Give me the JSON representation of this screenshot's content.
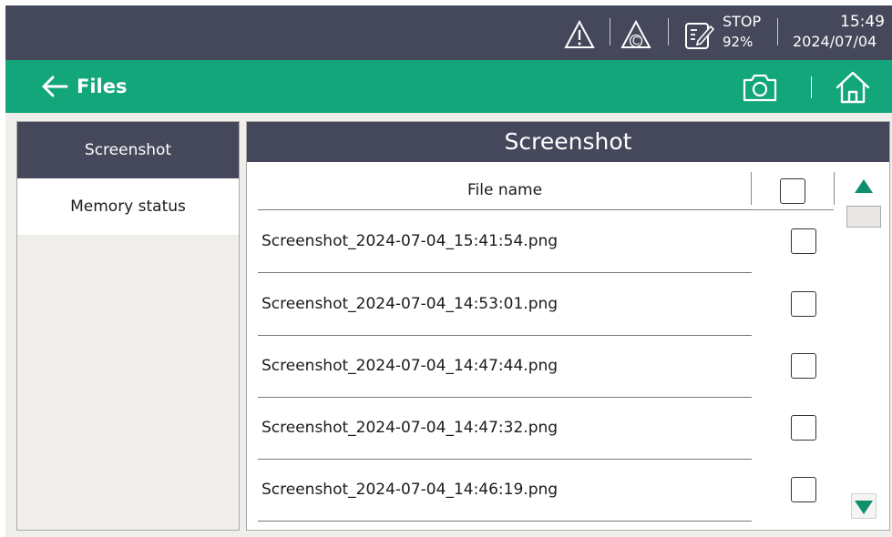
{
  "status_bar": {
    "run_state": "STOP",
    "percent": "92%",
    "time": "15:49",
    "date": "2024/07/04",
    "icons": [
      "warning-icon",
      "caution-c-icon",
      "edit-document-icon"
    ]
  },
  "title_bar": {
    "title": "Files",
    "back_icon": "arrow-left-icon",
    "camera_icon": "camera-icon",
    "home_icon": "home-icon"
  },
  "sidebar": {
    "items": [
      {
        "label": "Screenshot",
        "active": true
      },
      {
        "label": "Memory status",
        "active": false
      }
    ]
  },
  "panel": {
    "title": "Screenshot",
    "column_header": "File name",
    "select_all_checked": false,
    "files": [
      {
        "name": "Screenshot_2024-07-04_15:41:54.png",
        "checked": false
      },
      {
        "name": "Screenshot_2024-07-04_14:53:01.png",
        "checked": false
      },
      {
        "name": "Screenshot_2024-07-04_14:47:44.png",
        "checked": false
      },
      {
        "name": "Screenshot_2024-07-04_14:47:32.png",
        "checked": false
      },
      {
        "name": "Screenshot_2024-07-04_14:46:19.png",
        "checked": false
      }
    ]
  },
  "colors": {
    "dark_bar": "#45485a",
    "accent_green": "#12a67a",
    "scroll_arrow": "#0f8f6c",
    "content_bg": "#f0eeea"
  }
}
